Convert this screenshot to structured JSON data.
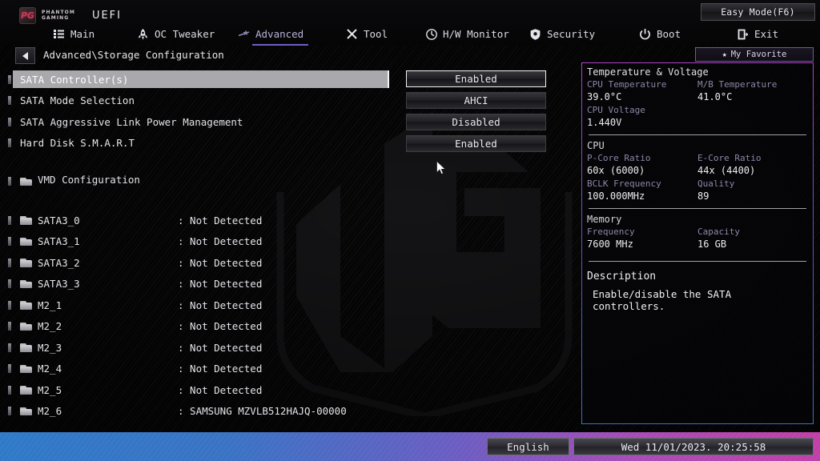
{
  "header": {
    "brand_line1": "PHANTOM",
    "brand_line2": "GAMING",
    "brand_mark": "PG",
    "uefi_label": "UEFI",
    "easy_mode_label": "Easy Mode(F6)",
    "tabs": [
      {
        "label": "Main",
        "icon": "list-icon",
        "active": false
      },
      {
        "label": "OC Tweaker",
        "icon": "rocket-icon",
        "active": false
      },
      {
        "label": "Advanced",
        "icon": "sliders-icon",
        "active": true
      },
      {
        "label": "Tool",
        "icon": "tools-icon",
        "active": false
      },
      {
        "label": "H/W Monitor",
        "icon": "gauge-icon",
        "active": false
      },
      {
        "label": "Security",
        "icon": "shield-icon",
        "active": false
      },
      {
        "label": "Boot",
        "icon": "power-icon",
        "active": false
      },
      {
        "label": "Exit",
        "icon": "exit-icon",
        "active": false
      }
    ]
  },
  "breadcrumb": {
    "back_icon": "back-arrow-icon",
    "path": "Advanced\\Storage Configuration",
    "my_favorite_label": "My Favorite",
    "my_favorite_icon": "star-icon"
  },
  "settings": [
    {
      "label": "SATA Controller(s)",
      "value": "Enabled",
      "selected": true
    },
    {
      "label": "SATA Mode Selection",
      "value": "AHCI",
      "selected": false
    },
    {
      "label": "SATA Aggressive Link Power Management",
      "value": "Disabled",
      "selected": false
    },
    {
      "label": "Hard Disk S.M.A.R.T",
      "value": "Enabled",
      "selected": false
    }
  ],
  "submenu": {
    "label": "VMD Configuration",
    "icon": "folder-icon"
  },
  "devices": [
    {
      "name": "SATA3_0",
      "value": ": Not Detected"
    },
    {
      "name": "SATA3_1",
      "value": ": Not Detected"
    },
    {
      "name": "SATA3_2",
      "value": ": Not Detected"
    },
    {
      "name": "SATA3_3",
      "value": ": Not Detected"
    },
    {
      "name": "M2_1",
      "value": ": Not Detected"
    },
    {
      "name": "M2_2",
      "value": ": Not Detected"
    },
    {
      "name": "M2_3",
      "value": ": Not Detected"
    },
    {
      "name": "M2_4",
      "value": ": Not Detected"
    },
    {
      "name": "M2_5",
      "value": ": Not Detected"
    },
    {
      "name": "M2_6",
      "value": ": SAMSUNG MZVLB512HAJQ-00000"
    }
  ],
  "info_panel": {
    "temp_voltage": {
      "title": "Temperature & Voltage",
      "cpu_temp_label": "CPU Temperature",
      "cpu_temp_value": "39.0°C",
      "mb_temp_label": "M/B Temperature",
      "mb_temp_value": "41.0°C",
      "cpu_voltage_label": "CPU Voltage",
      "cpu_voltage_value": "1.440V"
    },
    "cpu": {
      "title": "CPU",
      "pcore_label": "P-Core Ratio",
      "pcore_value": "60x (6000)",
      "ecore_label": "E-Core Ratio",
      "ecore_value": "44x (4400)",
      "bclk_label": "BCLK Frequency",
      "bclk_value": "100.000MHz",
      "quality_label": "Quality",
      "quality_value": "89"
    },
    "memory": {
      "title": "Memory",
      "freq_label": "Frequency",
      "freq_value": "7600 MHz",
      "cap_label": "Capacity",
      "cap_value": "16 GB"
    },
    "description": {
      "title": "Description",
      "text": "Enable/disable the SATA controllers."
    }
  },
  "bottom_bar": {
    "language": "English",
    "datetime": "Wed 11/01/2023. 20:25:58"
  },
  "colors": {
    "accent_purple": "#6d5fc4",
    "accent_magenta": "#c040a8",
    "accent_blue": "#2f7ac8",
    "selection_gray": "#a9a9ad",
    "panel_label": "#8e86a6"
  }
}
